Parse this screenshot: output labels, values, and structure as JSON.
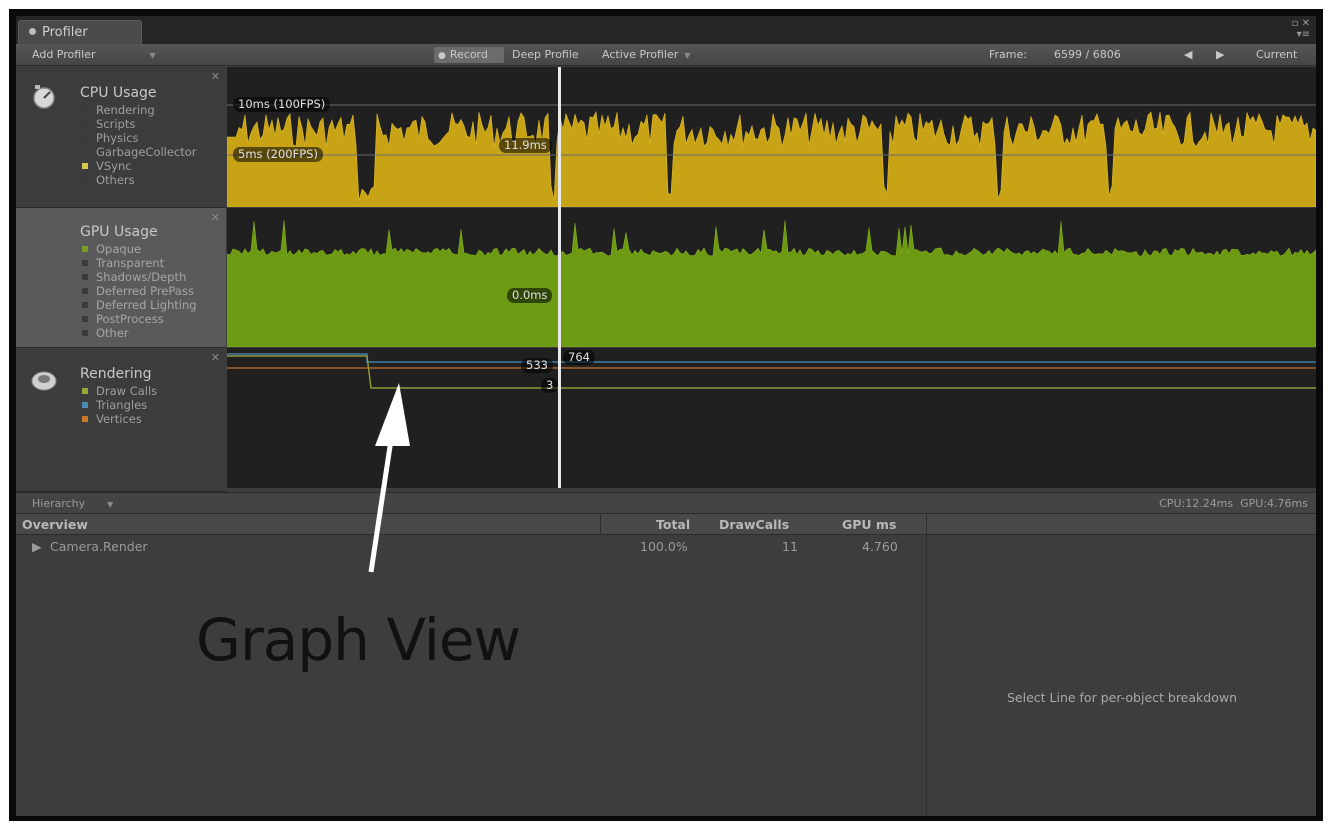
{
  "window": {
    "tab_title": "Profiler"
  },
  "toolbar": {
    "add_profiler": "Add Profiler",
    "record": "Record",
    "deep_profile": "Deep Profile",
    "active_profiler": "Active Profiler",
    "frame_label": "Frame:",
    "frame_value": "6599 / 6806",
    "current": "Current"
  },
  "modules": {
    "cpu": {
      "title": "CPU Usage",
      "items": [
        {
          "label": "Rendering",
          "color": "#3a3a3a"
        },
        {
          "label": "Scripts",
          "color": "#3a3a3a"
        },
        {
          "label": "Physics",
          "color": "#3a3a3a"
        },
        {
          "label": "GarbageCollector",
          "color": "#3a3a3a"
        },
        {
          "label": "VSync",
          "color": "#d6c84a"
        },
        {
          "label": "Others",
          "color": "#3a3a3a"
        }
      ],
      "line_10ms": "10ms (100FPS)",
      "line_5ms": "5ms (200FPS)",
      "selected_value": "11.9ms"
    },
    "gpu": {
      "title": "GPU Usage",
      "items": [
        {
          "label": "Opaque",
          "color": "#7a9a2a"
        },
        {
          "label": "Transparent",
          "color": "#3a3a3a"
        },
        {
          "label": "Shadows/Depth",
          "color": "#3a3a3a"
        },
        {
          "label": "Deferred PrePass",
          "color": "#3a3a3a"
        },
        {
          "label": "Deferred Lighting",
          "color": "#3a3a3a"
        },
        {
          "label": "PostProcess",
          "color": "#3a3a3a"
        },
        {
          "label": "Other",
          "color": "#3a3a3a"
        }
      ],
      "selected_value": "0.0ms"
    },
    "rendering": {
      "title": "Rendering",
      "items": [
        {
          "label": "Draw Calls",
          "color": "#9aa83a"
        },
        {
          "label": "Triangles",
          "color": "#4a8ab0"
        },
        {
          "label": "Vertices",
          "color": "#c87a2a"
        }
      ],
      "value_triangles": "764",
      "value_vertices": "533",
      "value_drawcalls": "3"
    }
  },
  "hierarchy": {
    "mode": "Hierarchy",
    "cpu_time": "CPU:12.24ms",
    "gpu_time": "GPU:4.76ms",
    "columns": [
      "Overview",
      "Total",
      "DrawCalls",
      "GPU ms"
    ],
    "rows": [
      {
        "name": "Camera.Render",
        "total": "100.0%",
        "drawcalls": "11",
        "gpu_ms": "4.760"
      }
    ],
    "detail_message": "Select Line for per-object breakdown"
  },
  "annotation": {
    "text": "Graph View"
  }
}
